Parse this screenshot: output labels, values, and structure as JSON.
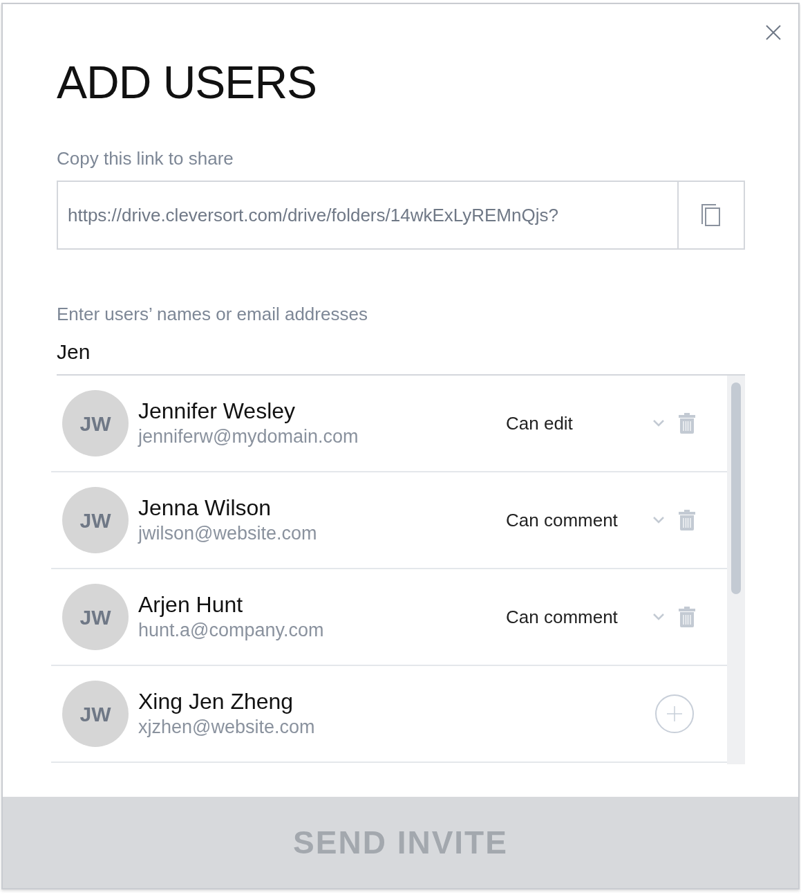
{
  "dialog": {
    "title": "ADD USERS"
  },
  "share": {
    "label": "Copy this link to share",
    "link": "https://drive.cleversort.com/drive/folders/14wkExLyREMnQjs?"
  },
  "invite": {
    "label": "Enter users’ names or email addresses",
    "value": "Jen"
  },
  "users": [
    {
      "kind": "added",
      "initials": "JW",
      "name": "Jennifer Wesley",
      "email": "jenniferw@mydomain.com",
      "permission": "Can edit"
    },
    {
      "kind": "added",
      "initials": "JW",
      "name": "Jenna Wilson",
      "email": "jwilson@website.com",
      "permission": "Can comment"
    },
    {
      "kind": "added",
      "initials": "JW",
      "name": "Arjen Hunt",
      "email": "hunt.a@company.com",
      "permission": "Can comment"
    },
    {
      "kind": "suggestion",
      "initials": "JW",
      "name": "Xing Jen Zheng",
      "email": "xjzhen@website.com"
    }
  ],
  "send_button": {
    "label": "SEND INVITE",
    "disabled": true
  }
}
